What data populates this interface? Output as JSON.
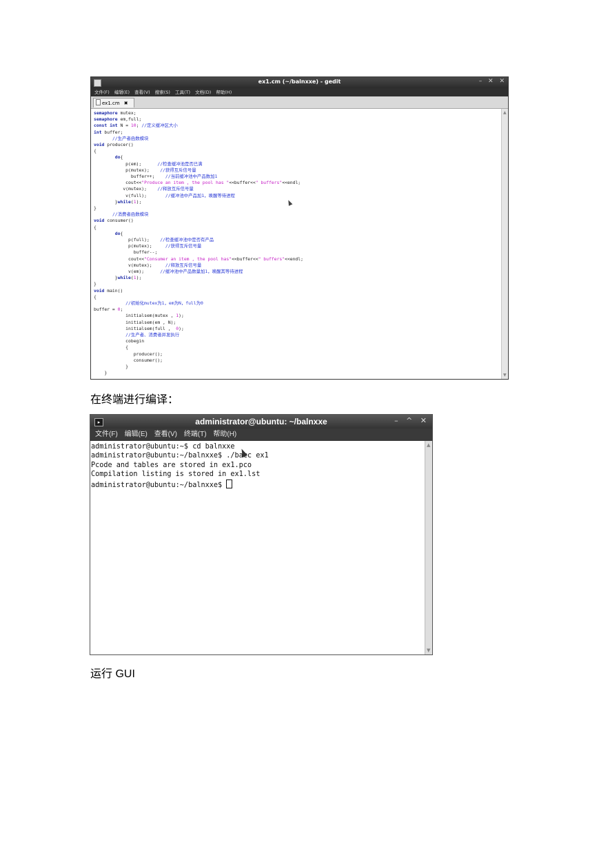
{
  "gedit": {
    "title": "ex1.cm (~/balnxxe) - gedit",
    "window_buttons": "– ✕ ✕",
    "menu": [
      "文件(F)",
      "编辑(E)",
      "查看(V)",
      "搜索(S)",
      "工具(T)",
      "文档(D)",
      "帮助(H)"
    ],
    "tab_label": "ex1.cm",
    "tab_close": "✖",
    "code": [
      "semaphore mutex;",
      "semaphore em,full;",
      "const int N = 10; //定义缓冲区大小",
      "int buffer;",
      "       //生产者函数模块",
      "void producer()",
      "{",
      "        do{",
      "            p(em);      //检查缓冲池是否已满",
      "            p(mutex);    //获得互斥信号量",
      "              buffer++;    //当前缓冲池中产品数加1",
      "            cout<<\"Produce an item , the pool has \"<<buffer<<\" buffers\"<<endl;",
      "           v(mutex);    //释放互斥信号量",
      "            v(full);       //缓冲池中产品加1，唤醒等待进程",
      "        }while(1);",
      "}",
      "       //消费者函数模块",
      "void consumer()",
      "{",
      "        do{",
      "             p(full);    //检查缓冲池中是否有产品",
      "             p(mutex);     //获得互斥信号量",
      "               buffer--;",
      "             cout<<\"Consumer an item , the pool has\"<<buffer<<\" buffers\"<<endl;",
      "             v(mutex);     //释放互斥信号量",
      "             v(em);      //缓冲池中产品数量加1，唤醒其等待进程",
      "        }while(1);",
      "}",
      "void main()",
      "{",
      "            //初始化mutex为1，em为N，full为0",
      "buffer = 0;",
      "            initialsem(mutex , 1);",
      "            initialsem(em , N);",
      "            initialsem(full ,  0);",
      "            //生产者、消费者并发执行",
      "            cobegin",
      "            {",
      "               producer();",
      "               consumer();",
      "            }",
      "    }"
    ]
  },
  "caption_compile": "在终端进行编译：",
  "terminal": {
    "title": "administrator@ubuntu: ~/balnxxe",
    "window_buttons": "– ^ ✕",
    "menu": [
      "文件(F)",
      "编辑(E)",
      "查看(V)",
      "终端(T)",
      "帮助(H)"
    ],
    "lines": [
      "administrator@ubuntu:~$ cd balnxxe",
      "administrator@ubuntu:~/balnxxe$ ./bacc ex1",
      "Pcode and tables are stored in ex1.pco",
      "Compilation listing is stored in ex1.lst",
      "administrator@ubuntu:~/balnxxe$ "
    ]
  },
  "caption_run": "运行 GUI"
}
